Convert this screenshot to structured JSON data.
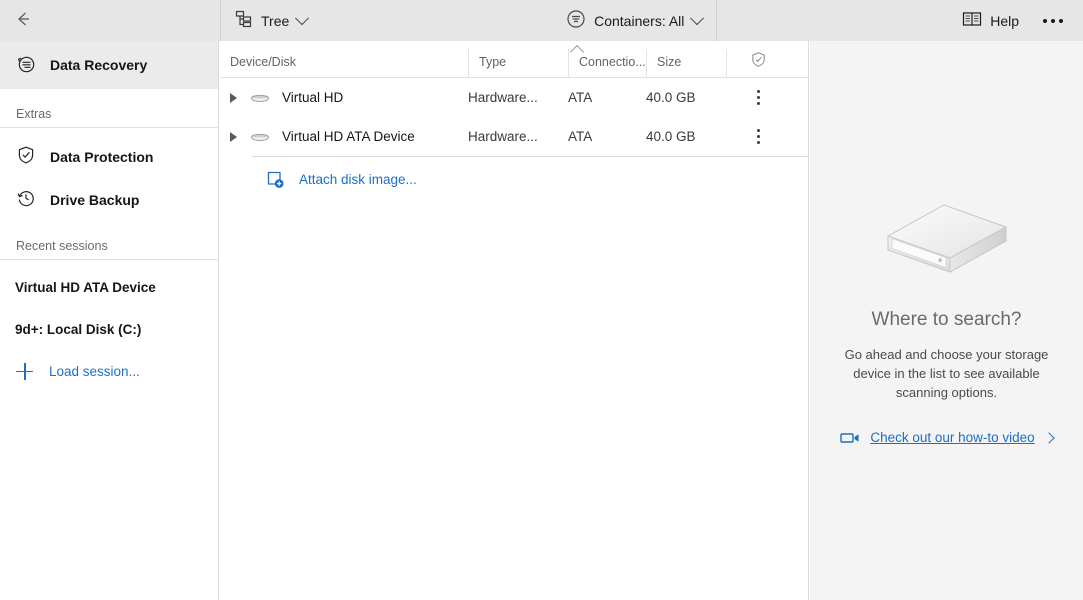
{
  "toolbar": {
    "back_icon": "arrow-left-icon",
    "tree_icon": "tree-hierarchy-icon",
    "tree_label": "Tree",
    "containers_icon": "filter-circle-icon",
    "containers_label": "Containers: All",
    "help_icon": "book-icon",
    "help_label": "Help",
    "more_icon": "ellipsis-icon"
  },
  "sidebar": {
    "active": {
      "label": "Data Recovery",
      "icon": "data-recovery-icon"
    },
    "extras_header": "Extras",
    "items": [
      {
        "label": "Data Protection",
        "icon": "shield-icon"
      },
      {
        "label": "Drive Backup",
        "icon": "clock-history-icon"
      }
    ],
    "recent_header": "Recent sessions",
    "sessions": [
      {
        "label": "Virtual HD ATA Device"
      },
      {
        "label": "9d+: Local Disk (C:)"
      }
    ],
    "load_session": {
      "label": "Load session...",
      "icon": "plus-icon"
    }
  },
  "list": {
    "columns": [
      {
        "key": "name",
        "label": "Device/Disk"
      },
      {
        "key": "type",
        "label": "Type"
      },
      {
        "key": "conn",
        "label": "Connectio..."
      },
      {
        "key": "size",
        "label": "Size"
      },
      {
        "key": "shield",
        "label": "",
        "icon": "shield-check-icon"
      }
    ],
    "sort": {
      "column": "Device/Disk",
      "direction": "ascending",
      "icon": "caret-up-icon"
    },
    "rows": [
      {
        "expander": "caret-right-icon",
        "icon": "disk-icon",
        "name": "Virtual HD",
        "type": "Hardware...",
        "conn": "ATA",
        "size": "40.0 GB",
        "menu": "kebab-menu-icon"
      },
      {
        "expander": "caret-right-icon",
        "icon": "disk-icon",
        "name": "Virtual HD ATA Device",
        "type": "Hardware...",
        "conn": "ATA",
        "size": "40.0 GB",
        "menu": "kebab-menu-icon"
      }
    ],
    "attach": {
      "label": "Attach disk image...",
      "icon": "attach-disk-image-icon"
    }
  },
  "right_panel": {
    "illustration": "external-hard-drive-illustration",
    "title": "Where to search?",
    "description": "Go ahead and choose your storage device in the list to see available scanning options.",
    "link": {
      "label": "Check out our how-to video",
      "icon": "video-camera-icon",
      "chevron": "chevron-right-icon"
    }
  },
  "colors": {
    "toolbar_bg": "#e6e6e6",
    "panel_bg": "#f4f4f4",
    "accent_link": "#1a6fc4",
    "sidebar_active_bg": "#ebebeb",
    "border": "#dcdcdc"
  }
}
